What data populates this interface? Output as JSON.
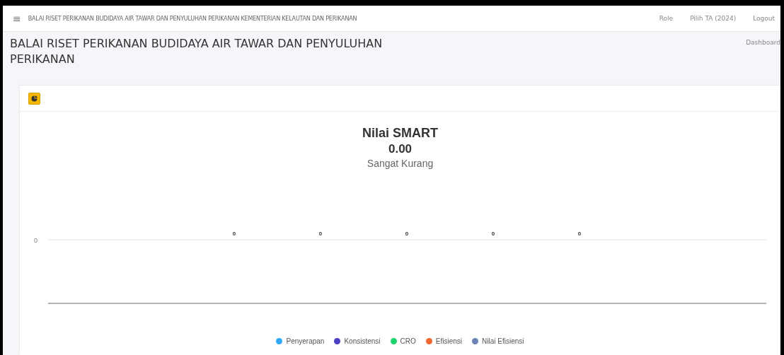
{
  "navbar": {
    "menu_icon": "≡",
    "title": "BALAI RISET PERIKANAN BUDIDAYA AIR TAWAR DAN PENYULUHAN PERIKANAN KEMENTERIAN KELAUTAN DAN PERIKANAN",
    "links": [
      "Role",
      "Pilih TA (2024)",
      "Logout"
    ]
  },
  "header": {
    "title": "BALAI RISET PERIKANAN BUDIDAYA AIR TAWAR DAN PENYULUHAN PERIKANAN",
    "breadcrumb": "Dashboard"
  },
  "card": {
    "summary": {
      "title": "Nilai SMART",
      "score": "0.00",
      "rating": "Sangat Kurang"
    },
    "chart": {
      "axis_tick": "0",
      "value_labels": [
        "0",
        "0",
        "0",
        "0",
        "0"
      ],
      "legend": [
        {
          "name": "Penyerapan",
          "color": "#2fa9f5"
        },
        {
          "name": "Konsistensi",
          "color": "#4b3fc4"
        },
        {
          "name": "CRO",
          "color": "#1dd36b"
        },
        {
          "name": "Efisiensi",
          "color": "#f2652d"
        },
        {
          "name": "Nilai Efisiensi",
          "color": "#6b84b5"
        }
      ]
    }
  }
}
